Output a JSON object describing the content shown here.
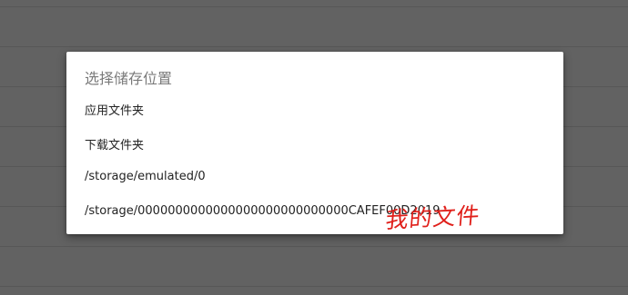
{
  "dialog": {
    "title": "选择储存位置",
    "options": [
      {
        "label": "应用文件夹"
      },
      {
        "label": "下载文件夹"
      },
      {
        "label": "/storage/emulated/0"
      },
      {
        "label": "/storage/0000000000000000000000000000CAFEF00D2019"
      }
    ]
  },
  "annotation": {
    "text": "我的文件",
    "color": "#e0201b"
  },
  "colors": {
    "backdrop": "#626262",
    "dialog_background": "#ffffff",
    "title_text": "#7a7a7a",
    "option_text": "#222222"
  }
}
